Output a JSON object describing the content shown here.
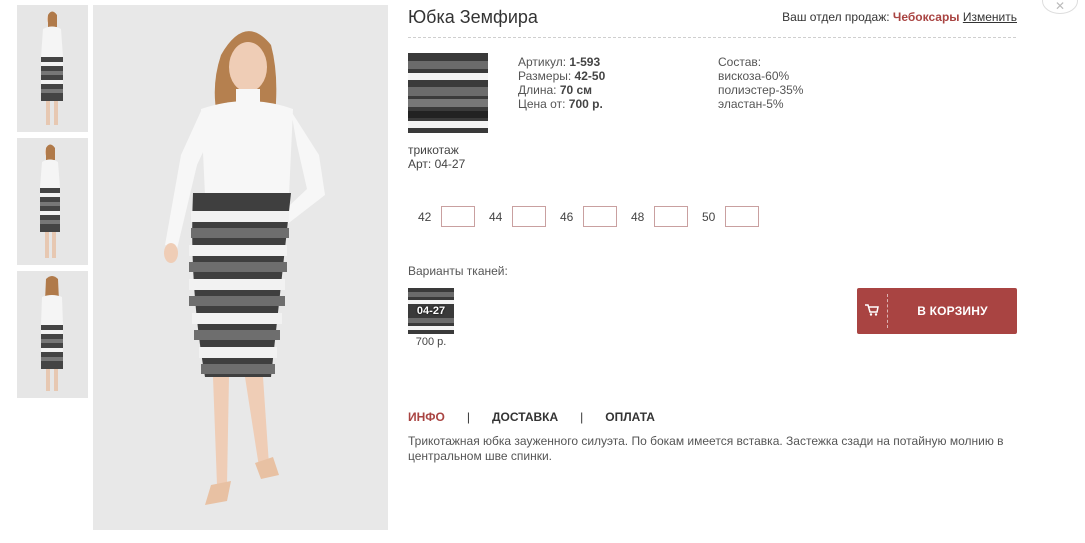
{
  "product": {
    "title": "Юбка Земфира"
  },
  "sales_region": {
    "prefix": "Ваш отдел продаж:",
    "city": "Чебоксары",
    "change_link": "Изменить"
  },
  "close_icon": "close-icon",
  "fabric": {
    "caption_line1": "трикотаж",
    "caption_line2": "Арт: 04-27"
  },
  "specs": {
    "article_label": "Артикул:",
    "article_value": "1-593",
    "sizes_label": "Размеры:",
    "sizes_value": "42-50",
    "length_label": "Длина:",
    "length_value": "70 см",
    "price_label": "Цена от:",
    "price_value": "700 р."
  },
  "composition": {
    "label": "Состав:",
    "items": [
      "вискоза-60%",
      "полиэстер-35%",
      "эластан-5%"
    ]
  },
  "size_options": [
    {
      "label": "42",
      "value": ""
    },
    {
      "label": "44",
      "value": ""
    },
    {
      "label": "46",
      "value": ""
    },
    {
      "label": "48",
      "value": ""
    },
    {
      "label": "50",
      "value": ""
    }
  ],
  "variants": {
    "label": "Варианты тканей:",
    "items": [
      {
        "code": "04-27",
        "price": "700 р."
      }
    ]
  },
  "cart": {
    "label": "В КОРЗИНУ",
    "icon": "cart-icon"
  },
  "tabs": [
    {
      "label": "ИНФО",
      "active": true
    },
    {
      "label": "ДОСТАВКА",
      "active": false
    },
    {
      "label": "ОПЛАТА",
      "active": false
    }
  ],
  "tab_separator": "|",
  "description": "Трикотажная юбка зауженного силуэта. По бокам имеется вставка. Застежка сзади на потайную молнию в центральном шве спинки.",
  "colors": {
    "accent": "#a94442",
    "stripe_dark": "#3a3a3a",
    "stripe_grey": "#6b6b6b",
    "stripe_white": "#f4f4f4"
  }
}
